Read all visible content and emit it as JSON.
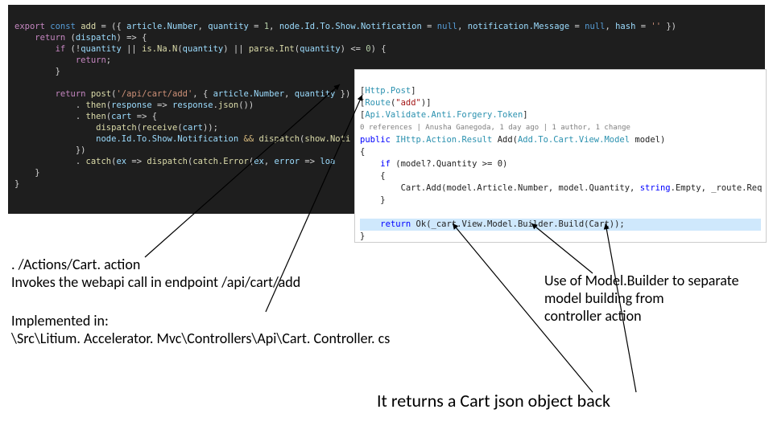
{
  "code_js": {
    "l1a": "export",
    "l1b": "const",
    "l1c": "add",
    "l1d": "= ({ ",
    "l1e": "article.Number",
    "l1f": ", ",
    "l1g": "quantity",
    "l1h": " = ",
    "l1i": "1",
    "l1j": ", ",
    "l1k": "node.Id.To.Show.Notification",
    "l1l": " = ",
    "l1m": "null",
    "l1n": ", ",
    "l1o": "notification.Message",
    "l1p": " = ",
    "l1q": "null",
    "l1r": ", ",
    "l1s": "hash",
    "l1t": " = ",
    "l1u": "''",
    "l1v": " })",
    "l2a": "return",
    "l2b": " (",
    "l2c": "dispatch",
    "l2d": ") => {",
    "l3a": "if",
    "l3b": " (!",
    "l3c": "quantity",
    "l3d": " || ",
    "l3e": "is.Na.N",
    "l3f": "(",
    "l3g": "quantity",
    "l3h": ") || ",
    "l3i": "parse.Int",
    "l3j": "(",
    "l3k": "quantity",
    "l3l": ") <= ",
    "l3m": "0",
    "l3n": ") {",
    "l4a": "return",
    "l4b": ";",
    "l5a": "}",
    "l6": "",
    "l7a": "return",
    "l7b": "post",
    "l7c": "(",
    "l7d": "'/api/cart/add'",
    "l7e": ", { ",
    "l7f": "article.Number",
    "l7g": ", ",
    "l7h": "quantity",
    "l7i": " })",
    "l8a": ". ",
    "l8b": "then",
    "l8c": "(",
    "l8d": "response",
    "l8e": " => ",
    "l8f": "response",
    "l8g": ".",
    "l8h": "json",
    "l8i": "())",
    "l9a": ". ",
    "l9b": "then",
    "l9c": "(",
    "l9d": "cart",
    "l9e": " => {",
    "l10a": "dispatch",
    "l10b": "(",
    "l10c": "receive",
    "l10d": "(",
    "l10e": "cart",
    "l10f": "));",
    "l11a": "node.Id.To.Show.Notification",
    "l11b": " && ",
    "l11c": "dispatch",
    "l11d": "(",
    "l11e": "show.Noti",
    "l12a": "})",
    "l13a": ". ",
    "l13b": "catch",
    "l13c": "(",
    "l13d": "ex",
    "l13e": " => ",
    "l13f": "dispatch",
    "l13g": "(",
    "l13h": "catch.Error",
    "l13i": "(",
    "l13j": "ex",
    "l13k": ", ",
    "l13l": "error",
    "l13m": " => ",
    "l13n": "loa",
    "l14a": "}",
    "l15a": "}"
  },
  "code_cs": {
    "a1a": "[",
    "a1b": "Http.Post",
    "a1c": "]",
    "a2a": "[",
    "a2b": "Route",
    "a2c": "(",
    "a2d": "\"add\"",
    "a2e": ")]",
    "a3a": "[",
    "a3b": "Api.Validate.Anti.Forgery.Token",
    "a3c": "]",
    "meta": "0 references | Anusha Ganegoda, 1 day ago | 1 author, 1 change",
    "s1a": "public",
    "s1b": " ",
    "s1c": "IHttp.Action.Result",
    "s1d": " Add(",
    "s1e": "Add.To.Cart.View.Model",
    "s1f": " model)",
    "b1": "{",
    "c1a": "if",
    "c1b": " (model?.Quantity >= 0)",
    "c2": "{",
    "c3a": "Cart.Add(model.Article.Number, model.Quantity, ",
    "c3b": "string",
    "c3c": ".Empty, _route.Req",
    "c4": "}",
    "blank": "",
    "r1a": "return",
    "r1b": " Ok(_cart.View.Model.Builder.Build(Cart));",
    "b2": "}"
  },
  "annotations": {
    "left1": ". /Actions/Cart. action",
    "left2": "Invokes the webapi call in endpoint /api/cart/add",
    "impl1": "Implemented in:",
    "impl2": "\\Src\\Litium. Accelerator. Mvc\\Controllers\\Api\\Cart. Controller. cs",
    "right1": "Use of Model.Builder to separate",
    "right2": "model building from",
    "right3": "controller action",
    "bottom": "It returns a Cart json object back"
  }
}
